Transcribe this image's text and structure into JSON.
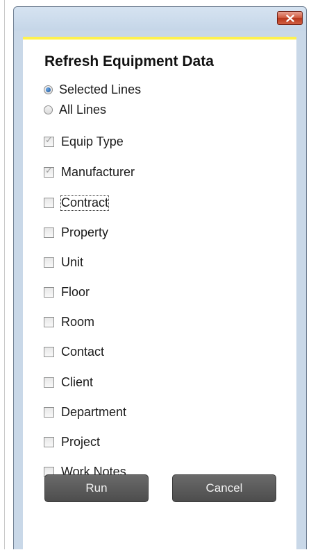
{
  "dialog": {
    "title": "Refresh Equipment Data"
  },
  "radios": [
    {
      "label": "Selected Lines",
      "checked": true
    },
    {
      "label": "All Lines",
      "checked": false
    }
  ],
  "checkboxes": [
    {
      "label": "Equip Type",
      "checked": true,
      "disabled": true
    },
    {
      "label": "Manufacturer",
      "checked": true,
      "disabled": true
    },
    {
      "label": "Contract",
      "checked": false,
      "focused": true
    },
    {
      "label": "Property",
      "checked": false
    },
    {
      "label": "Unit",
      "checked": false
    },
    {
      "label": "Floor",
      "checked": false
    },
    {
      "label": "Room",
      "checked": false
    },
    {
      "label": "Contact",
      "checked": false
    },
    {
      "label": "Client",
      "checked": false
    },
    {
      "label": "Department",
      "checked": false
    },
    {
      "label": "Project",
      "checked": false
    },
    {
      "label": "Work Notes",
      "checked": false
    }
  ],
  "buttons": {
    "run_label": "Run",
    "cancel_label": "Cancel"
  },
  "colors": {
    "frame": "#c9d8e8",
    "accent_bar": "#fff24d",
    "close_button": "#c9472a",
    "button_bg": "#5a5a5a"
  },
  "icons": {
    "close": "close-x-icon"
  }
}
